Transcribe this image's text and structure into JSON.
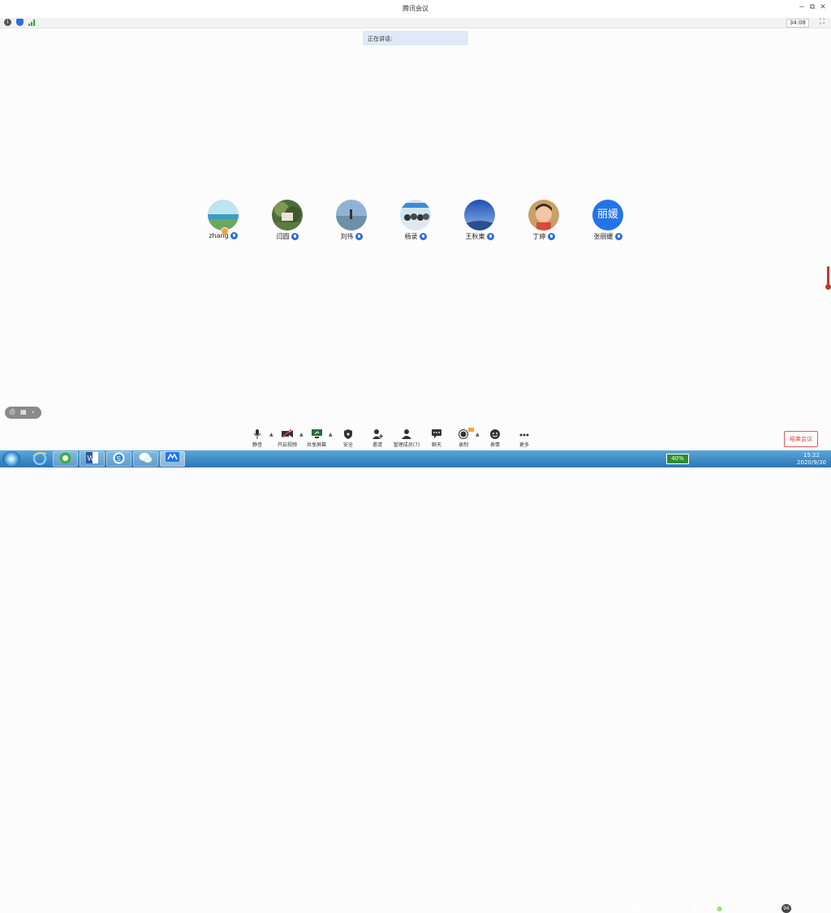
{
  "window": {
    "title": "腾讯会议",
    "controls": [
      "−",
      "⧉",
      "✕"
    ]
  },
  "infobar": {
    "icons": [
      "info-icon",
      "shield-icon",
      "signal-icon"
    ],
    "timer": "34:08",
    "fullscreen_icon": "fullscreen-icon"
  },
  "speaking_banner": "正在讲话:",
  "participants": [
    {
      "name": "zhang",
      "avatar": "lake-photo",
      "host": true
    },
    {
      "name": "闫圆",
      "avatar": "garden-photo"
    },
    {
      "name": "刘伟",
      "avatar": "beach-photo"
    },
    {
      "name": "杨录",
      "avatar": "group-photo"
    },
    {
      "name": "王秋東",
      "avatar": "sky-photo"
    },
    {
      "name": "丁婷",
      "avatar": "face-photo"
    },
    {
      "name": "张丽媛",
      "avatar_text": "丽媛"
    }
  ],
  "toolbar": {
    "mute": "静音",
    "video": "开启视频",
    "share": "共享屏幕",
    "security": "安全",
    "invite": "邀请",
    "members": "管理成员(7)",
    "chat": "聊天",
    "record": "录制",
    "reaction": "表情",
    "more": "更多",
    "end": "结束会议"
  },
  "taskbar": {
    "battery": "40%",
    "time": "15:22",
    "date": "2020/9/30",
    "badge": "96"
  },
  "colors": {
    "accent": "#2374e8",
    "end_red": "#e0413e",
    "banner": "#dfe9f7"
  }
}
